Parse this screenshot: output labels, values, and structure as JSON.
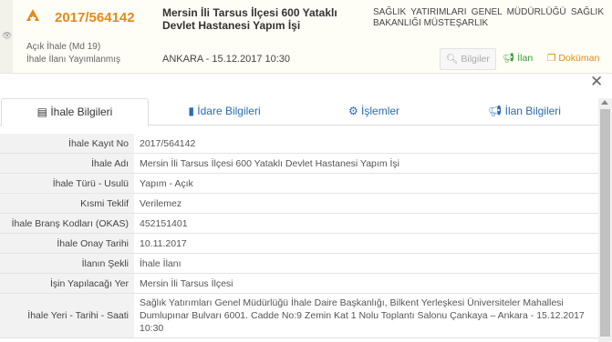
{
  "header": {
    "tender_icon": "bullhorn-icon",
    "tender_no": "2017/564142",
    "status_type": "Açık İhale (Md 19)",
    "status_stage": "İhale İlanı Yayımlanmış",
    "title": "Mersin İli Tarsus İlçesi 600 Yataklı Devlet Hastanesi Yapım İşi",
    "place_date": "ANKARA - 15.12.2017 10:30",
    "admin": "SAĞLIK YATIRIMLARI GENEL MÜDÜRLÜĞÜ SAĞLIK BAKANLIĞI MÜSTEŞARLIK",
    "buttons": {
      "bilgiler": "Bilgiler",
      "ilan": "İlan",
      "dokuman": "Doküman"
    }
  },
  "tabs": {
    "ihale": "İhale Bilgileri",
    "idare": "İdare Bilgileri",
    "islemler": "İşlemler",
    "ilan": "İlan Bilgileri"
  },
  "details": {
    "rows": [
      {
        "label": "İhale Kayıt No",
        "value": "2017/564142"
      },
      {
        "label": "İhale Adı",
        "value": "Mersin İli Tarsus İlçesi 600 Yataklı Devlet Hastanesi Yapım İşi"
      },
      {
        "label": "İhale Türü - Usulü",
        "value": "Yapım - Açık"
      },
      {
        "label": "Kısmi Teklif",
        "value": "Verilemez"
      },
      {
        "label": "İhale Branş Kodları (OKAS)",
        "value": "452151401"
      },
      {
        "label": "İhale Onay Tarihi",
        "value": "10.11.2017"
      },
      {
        "label": "İlanın Şekli",
        "value": "İhale İlanı"
      },
      {
        "label": "İşin Yapılacağı Yer",
        "value": "Mersin İli Tarsus İlçesi"
      },
      {
        "label": "İhale Yeri - Tarihi - Saati",
        "value": "Sağlık Yatırımları Genel Müdürlüğü İhale Daire Başkanlığı, Bilkent Yerleşkesi Üniversiteler Mahallesi Dumlupınar Bulvarı 6001. Cadde No:9 Zemin Kat 1 Nolu Toplantı Salonu Çankaya – Ankara - 15.12.2017 10:30"
      }
    ]
  }
}
